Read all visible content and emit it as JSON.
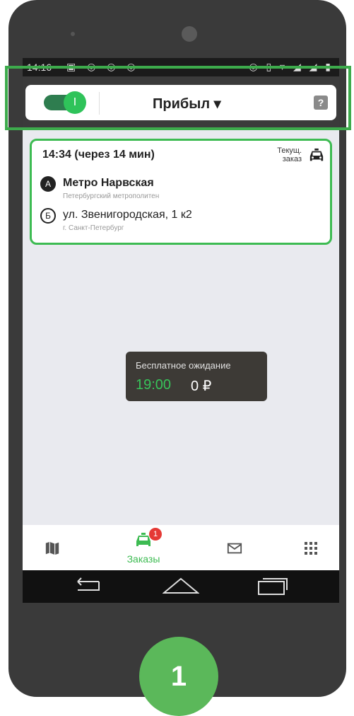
{
  "statusbar": {
    "time": "14:16",
    "icons_left": "▣ ◎ ◎ ◎",
    "icons_right": "◎ ▯ ▿ ◢ ◢ ▮"
  },
  "topbar": {
    "online_toggle": "on",
    "toggle_glyph": "I",
    "status": "Прибыл ▾",
    "help": "?"
  },
  "order": {
    "time": "14:34 (через 14 мин)",
    "current_label_line1": "Текущ.",
    "current_label_line2": "заказ",
    "icon": "taxi-icon",
    "point_a": {
      "marker": "А",
      "title": "Метро Нарвская",
      "subtitle": "Петербургский метрополитен"
    },
    "point_b": {
      "marker": "Б",
      "title": "ул. Звенигородская, 1 к2",
      "subtitle": "г. Санкт-Петербург"
    }
  },
  "waiting": {
    "label": "Бесплатное ожидание",
    "timer": "19:00",
    "price": "0 ₽"
  },
  "bottom_nav": {
    "map_icon": "map-icon",
    "orders_label": "Заказы",
    "orders_badge": "1",
    "messages_icon": "envelope-icon",
    "apps_icon": "grid-icon"
  },
  "step_number": "1",
  "colors": {
    "accent": "#3dbb52",
    "highlight": "#3dab4c",
    "badge": "#e53935",
    "wait_bg": "#3d3a36"
  }
}
